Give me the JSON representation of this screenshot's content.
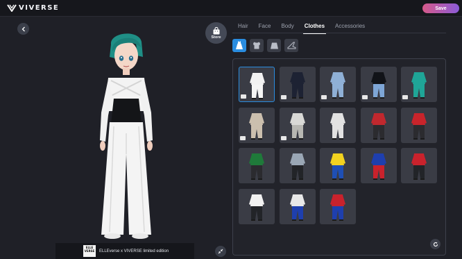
{
  "header": {
    "brand": "VIVERSE",
    "save_label": "Save"
  },
  "store": {
    "label": "Store"
  },
  "tabs": [
    {
      "label": "Hair",
      "active": false
    },
    {
      "label": "Face",
      "active": false
    },
    {
      "label": "Body",
      "active": false
    },
    {
      "label": "Clothes",
      "active": true
    },
    {
      "label": "Accessories",
      "active": false
    }
  ],
  "subcategories": [
    {
      "icon": "dress-icon",
      "active": true
    },
    {
      "icon": "top-icon",
      "active": false
    },
    {
      "icon": "bottom-icon",
      "active": false
    },
    {
      "icon": "shoe-icon",
      "active": false
    }
  ],
  "outfit_caption": {
    "brand_mark": "ELLE VERSE",
    "text": "ELLEverse x VIVERSE limited edition"
  },
  "outfits": [
    {
      "top": "#f2f2f2",
      "bottom": "#f5f5f5",
      "tagged": true,
      "selected": true
    },
    {
      "top": "#1d2233",
      "bottom": "#1d2233",
      "tagged": true,
      "selected": false
    },
    {
      "top": "#8fb0d6",
      "bottom": "#8fb0d6",
      "tagged": true,
      "selected": false
    },
    {
      "top": "#111318",
      "bottom": "#7ea6d6",
      "tagged": true,
      "selected": false
    },
    {
      "top": "#1fa597",
      "bottom": "#1fa597",
      "tagged": true,
      "selected": false
    },
    {
      "top": "#cbbfae",
      "bottom": "#cbbfae",
      "tagged": true,
      "selected": false
    },
    {
      "top": "#d9d9d6",
      "bottom": "#b7b7b2",
      "tagged": true,
      "selected": false
    },
    {
      "top": "#e2e2e2",
      "bottom": "#e2e2e2",
      "tagged": false,
      "selected": false
    },
    {
      "top": "#c0282e",
      "bottom": "#2b2b2f",
      "tagged": false,
      "selected": false
    },
    {
      "top": "#c8242b",
      "bottom": "#2b2b2f",
      "tagged": false,
      "selected": false
    },
    {
      "top": "#1f7a3a",
      "bottom": "#2b2b2f",
      "tagged": false,
      "selected": false
    },
    {
      "top": "#9aa7b5",
      "bottom": "#222428",
      "tagged": false,
      "selected": false
    },
    {
      "top": "#f2d21f",
      "bottom": "#1e4fb5",
      "tagged": false,
      "selected": false
    },
    {
      "top": "#1e3fae",
      "bottom": "#c9222c",
      "tagged": false,
      "selected": false
    },
    {
      "top": "#c9222c",
      "bottom": "#222428",
      "tagged": false,
      "selected": false
    },
    {
      "top": "#f2f2f2",
      "bottom": "#222428",
      "tagged": false,
      "selected": false
    },
    {
      "top": "#e8e8e8",
      "bottom": "#1e3fae",
      "tagged": false,
      "selected": false
    },
    {
      "top": "#c9222c",
      "bottom": "#1e3fae",
      "tagged": false,
      "selected": false
    }
  ]
}
